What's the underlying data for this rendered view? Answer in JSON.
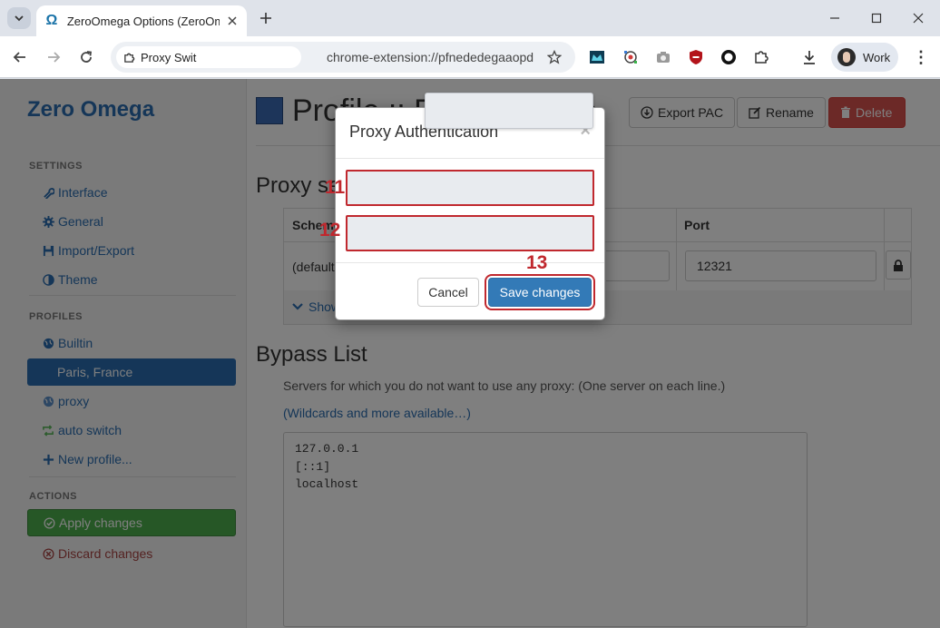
{
  "browser": {
    "tab_title": "ZeroOmega Options (ZeroOmega)",
    "site_chip": "Proxy SwitchyOmega",
    "url": "chrome-extension://pfnededegaaopdmhkdmcofjmoldfiped/options.html",
    "profile_label": "Work"
  },
  "sidebar": {
    "brand": "Zero Omega",
    "settings_header": "SETTINGS",
    "settings": [
      {
        "label": "Interface",
        "icon": "wrench-icon"
      },
      {
        "label": "General",
        "icon": "gear-icon"
      },
      {
        "label": "Import/Export",
        "icon": "floppy-icon"
      },
      {
        "label": "Theme",
        "icon": "contrast-icon"
      }
    ],
    "profiles_header": "PROFILES",
    "profiles": [
      {
        "label": "Builtin",
        "icon": "globe-icon"
      },
      {
        "label": "Paris, France",
        "icon": "none"
      },
      {
        "label": "proxy",
        "icon": "globe-icon"
      },
      {
        "label": "auto switch",
        "icon": "retweet-icon"
      },
      {
        "label": "New profile...",
        "icon": "plus-icon"
      }
    ],
    "actions_header": "ACTIONS",
    "apply_label": "Apply changes",
    "discard_label": "Discard changes"
  },
  "main": {
    "profile_title": "Profile :: Paris, France",
    "export_label": "Export PAC",
    "rename_label": "Rename",
    "delete_label": "Delete",
    "proxy_servers_title": "Proxy servers",
    "col_scheme": "Scheme",
    "col_port": "Port",
    "row_scheme": "(default)",
    "row_port": "12321",
    "show_advanced": "Show Advanced",
    "bypass_title": "Bypass List",
    "bypass_desc": "Servers for which you do not want to use any proxy: (One server on each line.)",
    "bypass_link": "(Wildcards and more available…)",
    "bypass_lines": [
      "127.0.0.1",
      "[::1]",
      "localhost"
    ]
  },
  "modal": {
    "title": "Proxy Authentication",
    "username_value": "",
    "password_value": "",
    "cancel_label": "Cancel",
    "save_label": "Save changes",
    "step_username": "11",
    "step_password": "12",
    "step_save": "13"
  },
  "colors": {
    "accent": "#2a6db0",
    "profile_color": "#3b6bb5",
    "annotation": "#c0282e",
    "apply": "#4cae4c",
    "danger": "#d9534f"
  }
}
